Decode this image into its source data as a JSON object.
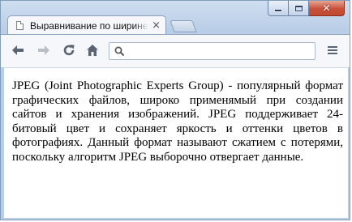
{
  "tab": {
    "title": "Выравнивание по ширине",
    "close_symbol": "×"
  },
  "window_controls": {
    "close_symbol": "✕"
  },
  "toolbar": {
    "icons": [
      "back-arrow-icon",
      "forward-arrow-icon",
      "reload-icon",
      "home-icon",
      "search-icon",
      "menu-icon"
    ],
    "omnibox_value": ""
  },
  "content": {
    "paragraph": "JPEG (Joint Photographic Experts Group) - популярный формат графических файлов, широко применямый при создании сайтов и хранения изображений. JPEG поддерживает 24-битовый цвет и сохраняет яркость и оттенки цветов в фотографиях. Данный формат называют сжатием с потерями, поскольку алгоритм JPEG выборочно отвергает данные."
  },
  "colors": {
    "frame": "#b9cde6",
    "close_button": "#c7503a",
    "toolbar": "#f5f7fa"
  }
}
